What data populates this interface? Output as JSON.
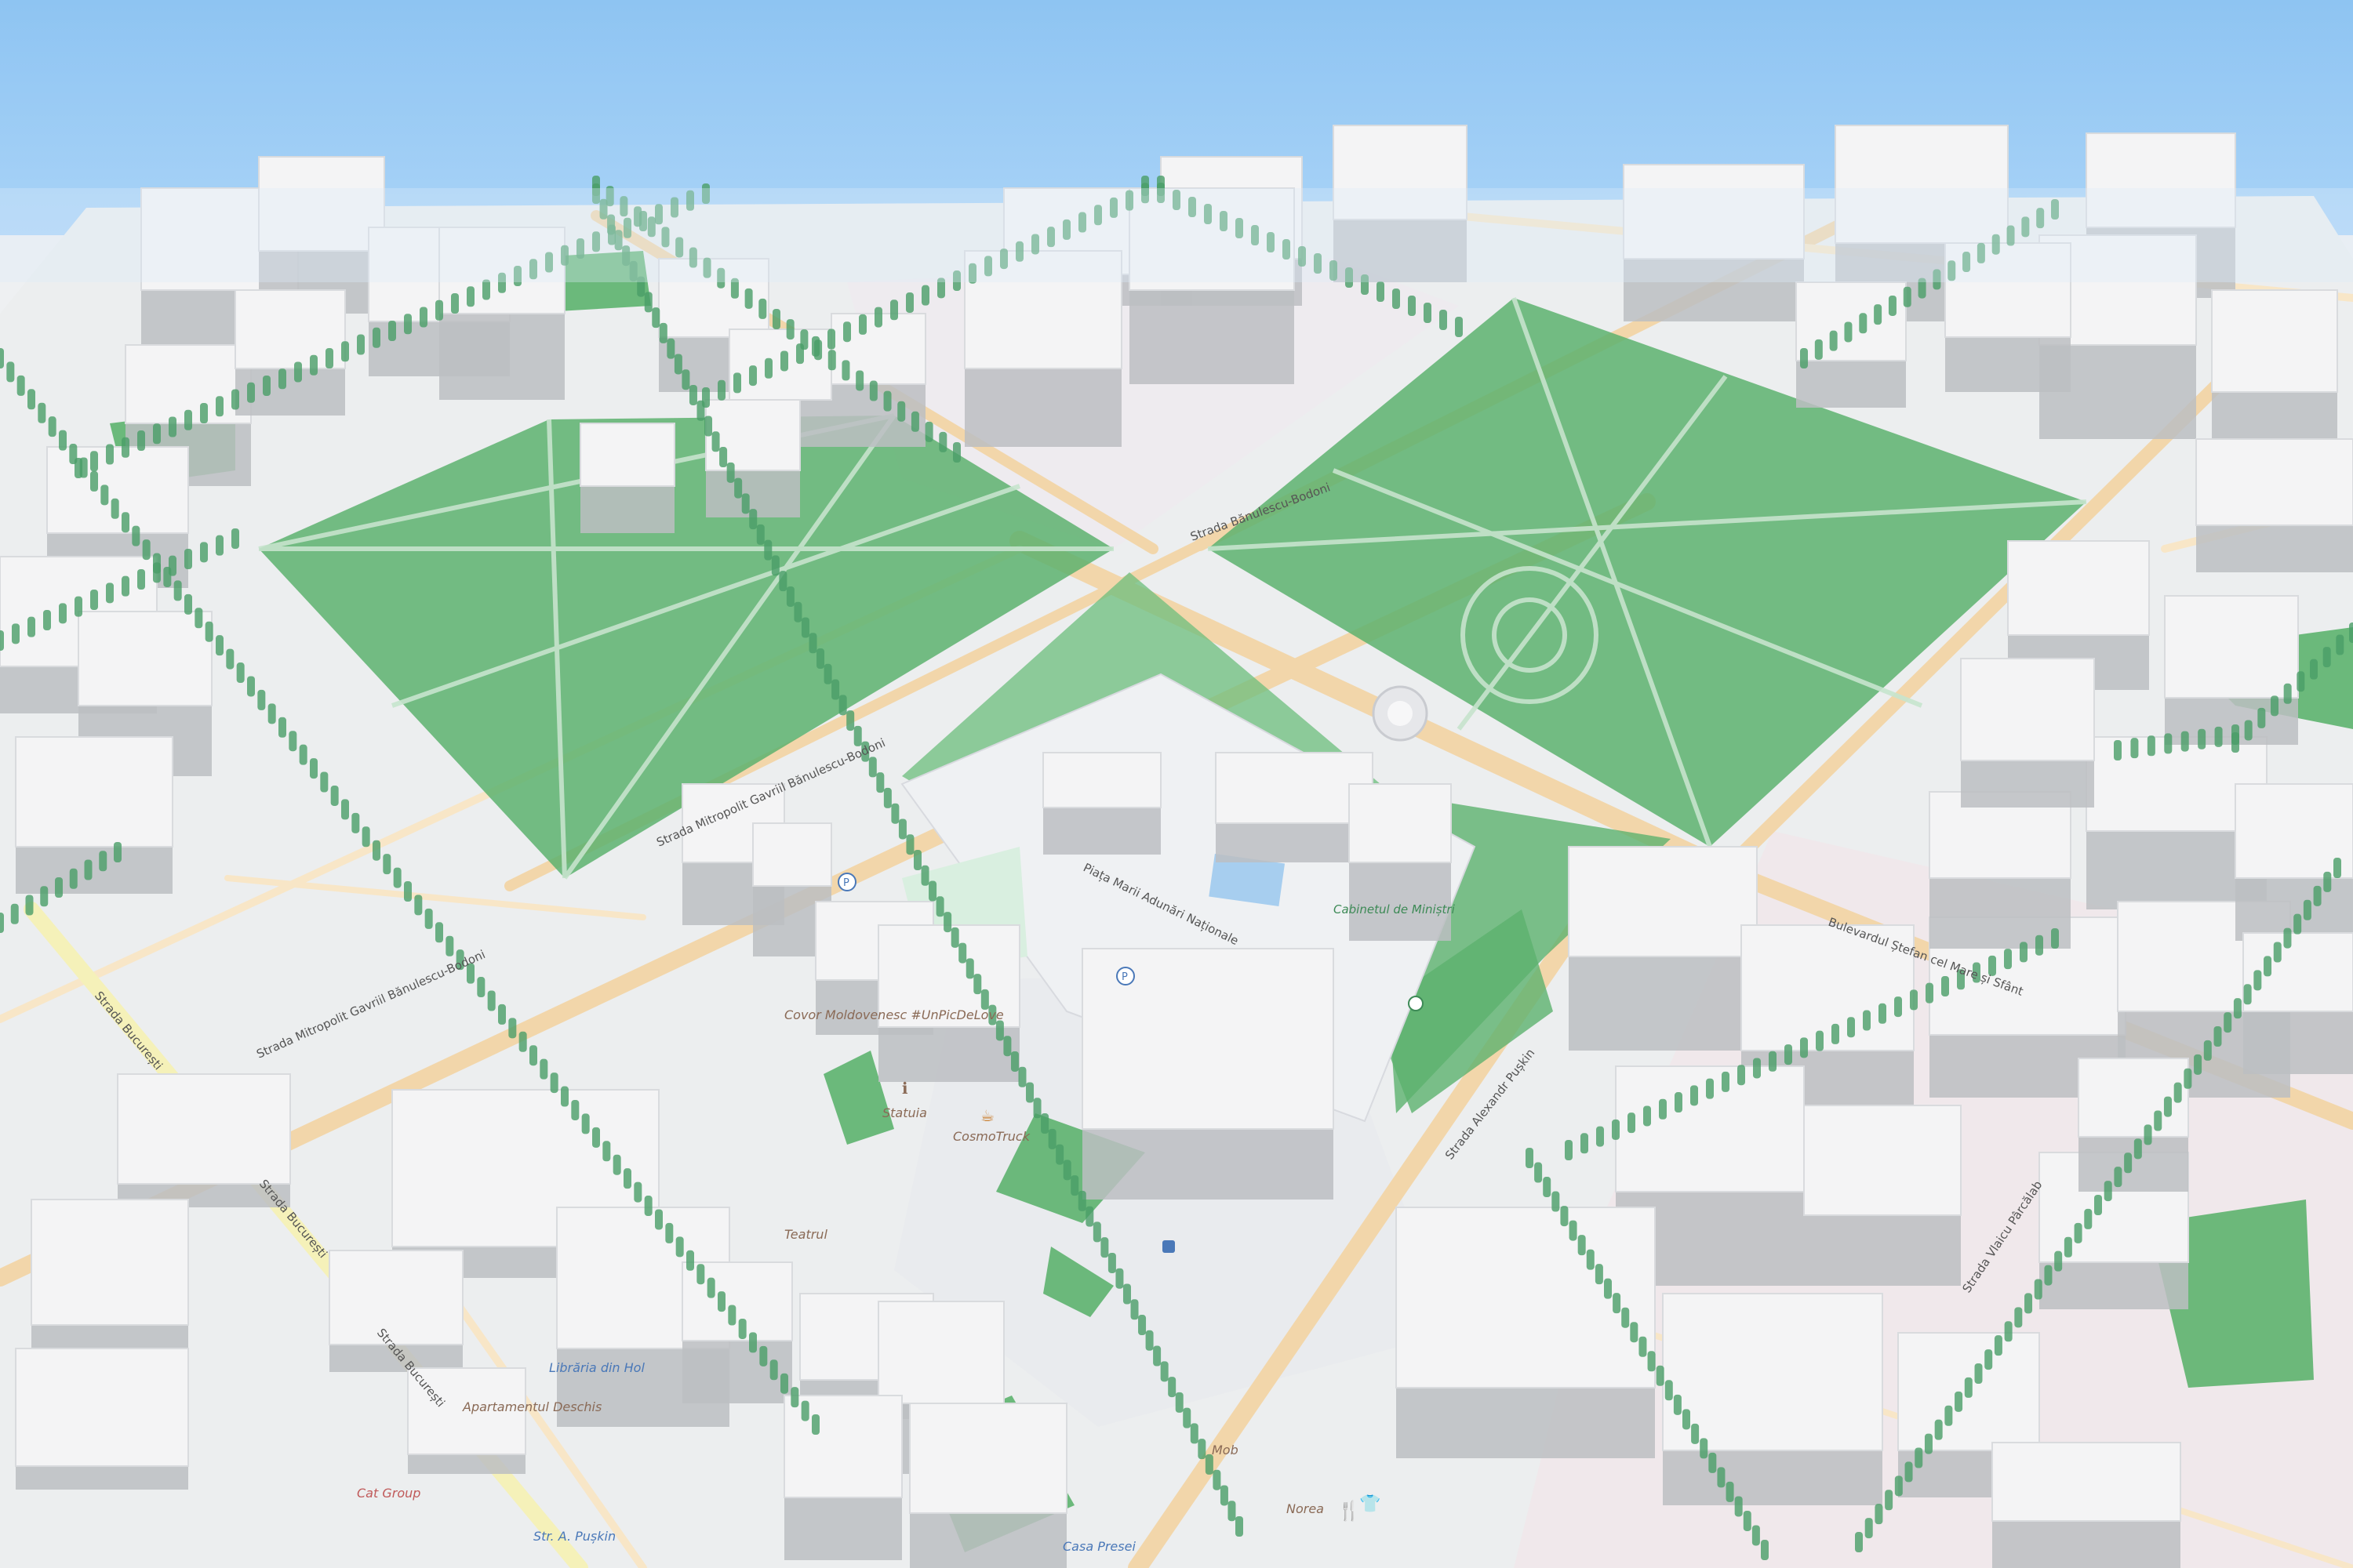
{
  "map": {
    "colors": {
      "sky": "#93c6f2",
      "ground": "#eceeef",
      "road": "#f3d9b0",
      "park": "#5db26e",
      "building_top": "#f4f4f5",
      "building_side": "#bcbec2",
      "tree": "#4a9e68"
    },
    "street_labels": [
      {
        "id": "str-mitropolit-gavriil-1",
        "text": "Strada Mitropolit Gavriil Bănulescu-Bodoni"
      },
      {
        "id": "str-mitropolit-gavriil-2",
        "text": "Strada Mitropolit Gavriil Bănulescu-Bodoni"
      },
      {
        "id": "str-bucuresti-1",
        "text": "Strada București"
      },
      {
        "id": "str-bucuresti-2",
        "text": "Strada București"
      },
      {
        "id": "str-bucuresti-3",
        "text": "Strada București"
      },
      {
        "id": "str-pushkin",
        "text": "Strada Alexandr Pușkin"
      },
      {
        "id": "str-vlaicu",
        "text": "Strada Vlaicu Pârcălab"
      },
      {
        "id": "bd-stefan",
        "text": "Bulevardul Ștefan cel Mare și Sfânt"
      },
      {
        "id": "str-bodoni-2",
        "text": "Strada Bănulescu-Bodoni"
      },
      {
        "id": "piata",
        "text": "Piața Marii Adunări Naționale"
      },
      {
        "id": "str-a-puskin",
        "text": "Str. A. Pușkin"
      }
    ],
    "poi_labels": [
      {
        "id": "apartamentul",
        "text": "Apartamentul Deschis"
      },
      {
        "id": "libraria",
        "text": "Librăria din Hol"
      },
      {
        "id": "casa-presei",
        "text": "Casa Presei"
      },
      {
        "id": "cosmo",
        "text": "CosmoTruck"
      },
      {
        "id": "covor",
        "text": "Covor Moldovenesc #UnPicDeLove"
      },
      {
        "id": "statuia",
        "text": "Statuia"
      },
      {
        "id": "teatrul",
        "text": "Teatrul"
      },
      {
        "id": "mob",
        "text": "Mob"
      },
      {
        "id": "norea",
        "text": "Norea"
      },
      {
        "id": "cabinetul",
        "text": "Cabinetul de Miniștri"
      },
      {
        "id": "ikea",
        "text": "Cat Group"
      }
    ],
    "icons": [
      "parking-icon",
      "fountain-icon",
      "monument-icon",
      "bus-stop-icon",
      "restaurant-icon",
      "cafe-icon",
      "shop-icon",
      "info-icon"
    ]
  }
}
